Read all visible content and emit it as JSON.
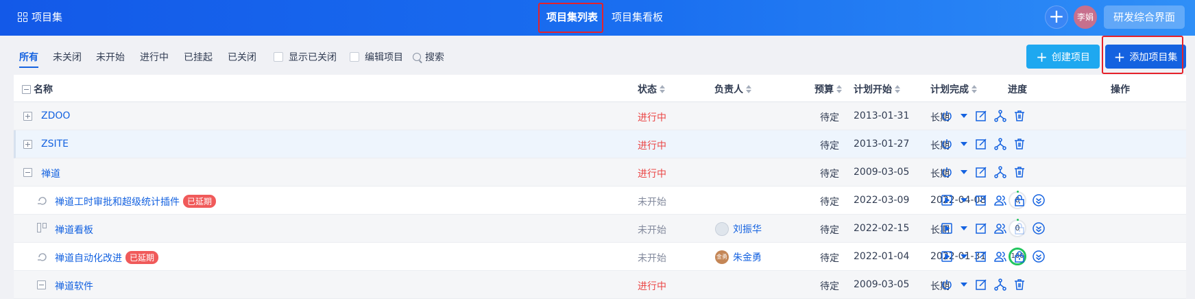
{
  "header": {
    "brand": "项目集",
    "tabs": [
      {
        "label": "项目集列表",
        "active": true
      },
      {
        "label": "项目集看板",
        "active": false
      }
    ],
    "avatar": "李娟",
    "switcher": "研发综合界面",
    "plus_icon": "plus-icon"
  },
  "toolbar": {
    "filters": [
      "所有",
      "未关闭",
      "未开始",
      "进行中",
      "已挂起",
      "已关闭"
    ],
    "show_closed": "显示已关闭",
    "edit_project": "编辑项目",
    "search": "搜索",
    "create_project": "创建项目",
    "add_program": "添加项目集"
  },
  "table": {
    "columns": {
      "name": "名称",
      "status": "状态",
      "owner": "负责人",
      "budget": "预算",
      "start": "计划开始",
      "end": "计划完成",
      "progress": "进度",
      "actions": "操作"
    },
    "rows": [
      {
        "name": "ZDOO",
        "status": "进行中",
        "budget": "待定",
        "start": "2013-01-31",
        "end": "长期"
      },
      {
        "name": "ZSITE",
        "status": "进行中",
        "budget": "待定",
        "start": "2013-01-27",
        "end": "长期"
      },
      {
        "name": "禅道",
        "status": "进行中",
        "budget": "待定",
        "start": "2009-03-05",
        "end": "长期"
      },
      {
        "name": "禅道工时审批和超级统计插件",
        "badge": "已延期",
        "status": "未开始",
        "budget": "待定",
        "start": "2022-03-09",
        "end": "2022-04-08",
        "progress": "0"
      },
      {
        "name": "禅道看板",
        "status": "未开始",
        "owner": "刘振华",
        "budget": "待定",
        "start": "2022-02-15",
        "end": "长期",
        "progress": "0"
      },
      {
        "name": "禅道自动化改进",
        "badge": "已延期",
        "status": "未开始",
        "owner": "朱金勇",
        "owner_avatar": "金勇",
        "budget": "待定",
        "start": "2022-01-04",
        "end": "2022-01-31",
        "progress": "100"
      },
      {
        "name": "禅道软件",
        "status": "进行中",
        "budget": "待定",
        "start": "2009-03-05",
        "end": "长期"
      }
    ]
  },
  "colors": {
    "primary": "#1462e0",
    "running": "#ea4545",
    "waiting": "#838a9d",
    "delay_badge": "#f05a5a",
    "create_button": "#1ea8f0"
  }
}
